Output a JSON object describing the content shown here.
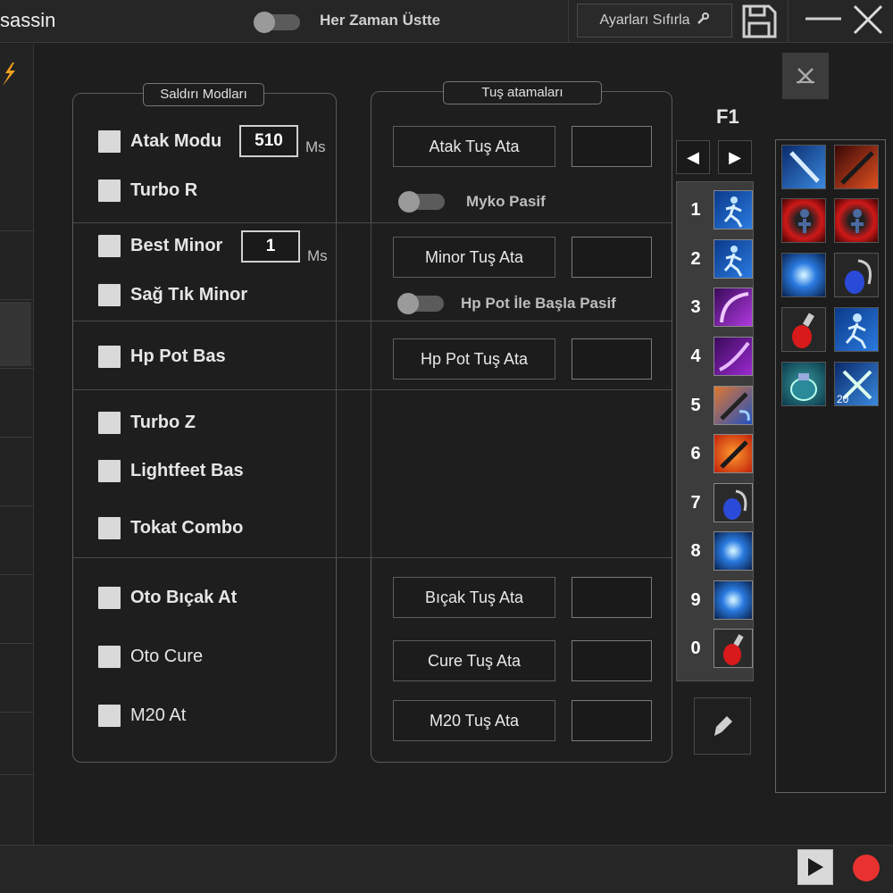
{
  "titlebar": {
    "title": "sassin",
    "topmost_label": "Her Zaman Üstte",
    "topmost_on": false,
    "reset_label": "Ayarları Sıfırla"
  },
  "attack_modes": {
    "legend": "Saldırı Modları",
    "atak_modu": {
      "label": "Atak Modu",
      "value": "510",
      "unit": "Ms",
      "checked": false
    },
    "turbo_r": {
      "label": "Turbo R",
      "checked": false
    },
    "best_minor": {
      "label": "Best Minor",
      "value": "1",
      "unit": "Ms",
      "checked": false
    },
    "sag_tik_minor": {
      "label": "Sağ Tık Minor",
      "checked": false
    },
    "hp_pot_bas": {
      "label": "Hp Pot Bas",
      "checked": false
    },
    "turbo_z": {
      "label": "Turbo Z",
      "checked": false
    },
    "lightfeet_bas": {
      "label": "Lightfeet Bas",
      "checked": false
    },
    "tokat_combo": {
      "label": "Tokat Combo",
      "checked": false
    },
    "oto_bicak_at": {
      "label": "Oto Bıçak At",
      "checked": false
    },
    "oto_cure": {
      "label": "Oto Cure",
      "checked": false
    },
    "m20_at": {
      "label": "M20 At",
      "checked": false
    }
  },
  "key_bindings": {
    "legend": "Tuş atamaları",
    "atak": {
      "button": "Atak Tuş Ata",
      "key": ""
    },
    "myko_toggle": {
      "label": "Myko Pasif",
      "on": false
    },
    "minor": {
      "button": "Minor Tuş Ata",
      "key": ""
    },
    "hp_pot_toggle": {
      "label": "Hp Pot İle Başla Pasif",
      "on": false
    },
    "hp_pot": {
      "button": "Hp Pot Tuş Ata",
      "key": ""
    },
    "bicak": {
      "button": "Bıçak Tuş Ata",
      "key": ""
    },
    "cure": {
      "button": "Cure Tuş Ata",
      "key": ""
    },
    "m20": {
      "button": "M20 Tuş Ata",
      "key": ""
    }
  },
  "hotbar": {
    "page_label": "F1",
    "prev_icon": "triangle-left-icon",
    "next_icon": "triangle-right-icon",
    "slots": [
      {
        "num": "1",
        "icon": "running-figure-icon"
      },
      {
        "num": "2",
        "icon": "running-figure-icon"
      },
      {
        "num": "3",
        "icon": "purple-slash-icon"
      },
      {
        "num": "4",
        "icon": "purple-slash-icon"
      },
      {
        "num": "5",
        "icon": "dagger-swirl-icon"
      },
      {
        "num": "6",
        "icon": "dagger-fire-icon"
      },
      {
        "num": "7",
        "icon": "blue-potion-icon"
      },
      {
        "num": "8",
        "icon": "blue-burst-icon"
      },
      {
        "num": "9",
        "icon": "blue-burst-icon"
      },
      {
        "num": "0",
        "icon": "red-potion-icon"
      }
    ]
  },
  "skill_panel": {
    "skills": [
      {
        "icon": "blue-dagger-icon",
        "count": ""
      },
      {
        "icon": "fire-dagger-icon",
        "count": ""
      },
      {
        "icon": "red-aura-figure-icon",
        "count": ""
      },
      {
        "icon": "red-aura-figure-icon",
        "count": ""
      },
      {
        "icon": "blue-burst-icon",
        "count": ""
      },
      {
        "icon": "blue-potion-icon",
        "count": ""
      },
      {
        "icon": "red-potion-icon",
        "count": ""
      },
      {
        "icon": "running-figure-icon",
        "count": ""
      },
      {
        "icon": "cure-jar-icon",
        "count": ""
      },
      {
        "icon": "crossed-daggers-icon",
        "count": "20"
      }
    ]
  },
  "colors": {
    "background": "#1e1e1e",
    "record": "#e8322f"
  }
}
